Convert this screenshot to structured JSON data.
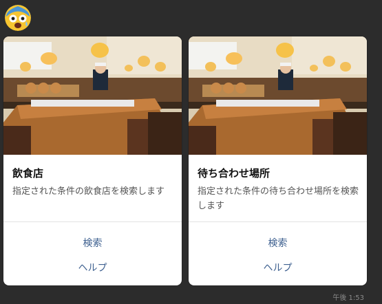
{
  "sender": {
    "avatar_icon": "shocked-face-icon"
  },
  "carousel": {
    "cards": [
      {
        "title": "飲食店",
        "description": "指定された条件の飲食店を検索します",
        "actions": [
          "検索",
          "ヘルプ"
        ]
      },
      {
        "title": "待ち合わせ場所",
        "description": "指定された条件の待ち合わせ場所を検索します",
        "actions": [
          "検索",
          "ヘルプ"
        ]
      }
    ]
  },
  "message": {
    "timestamp": "午後 1:53"
  },
  "colors": {
    "background": "#2c2c2c",
    "card": "#ffffff",
    "action_text": "#3f6190"
  }
}
